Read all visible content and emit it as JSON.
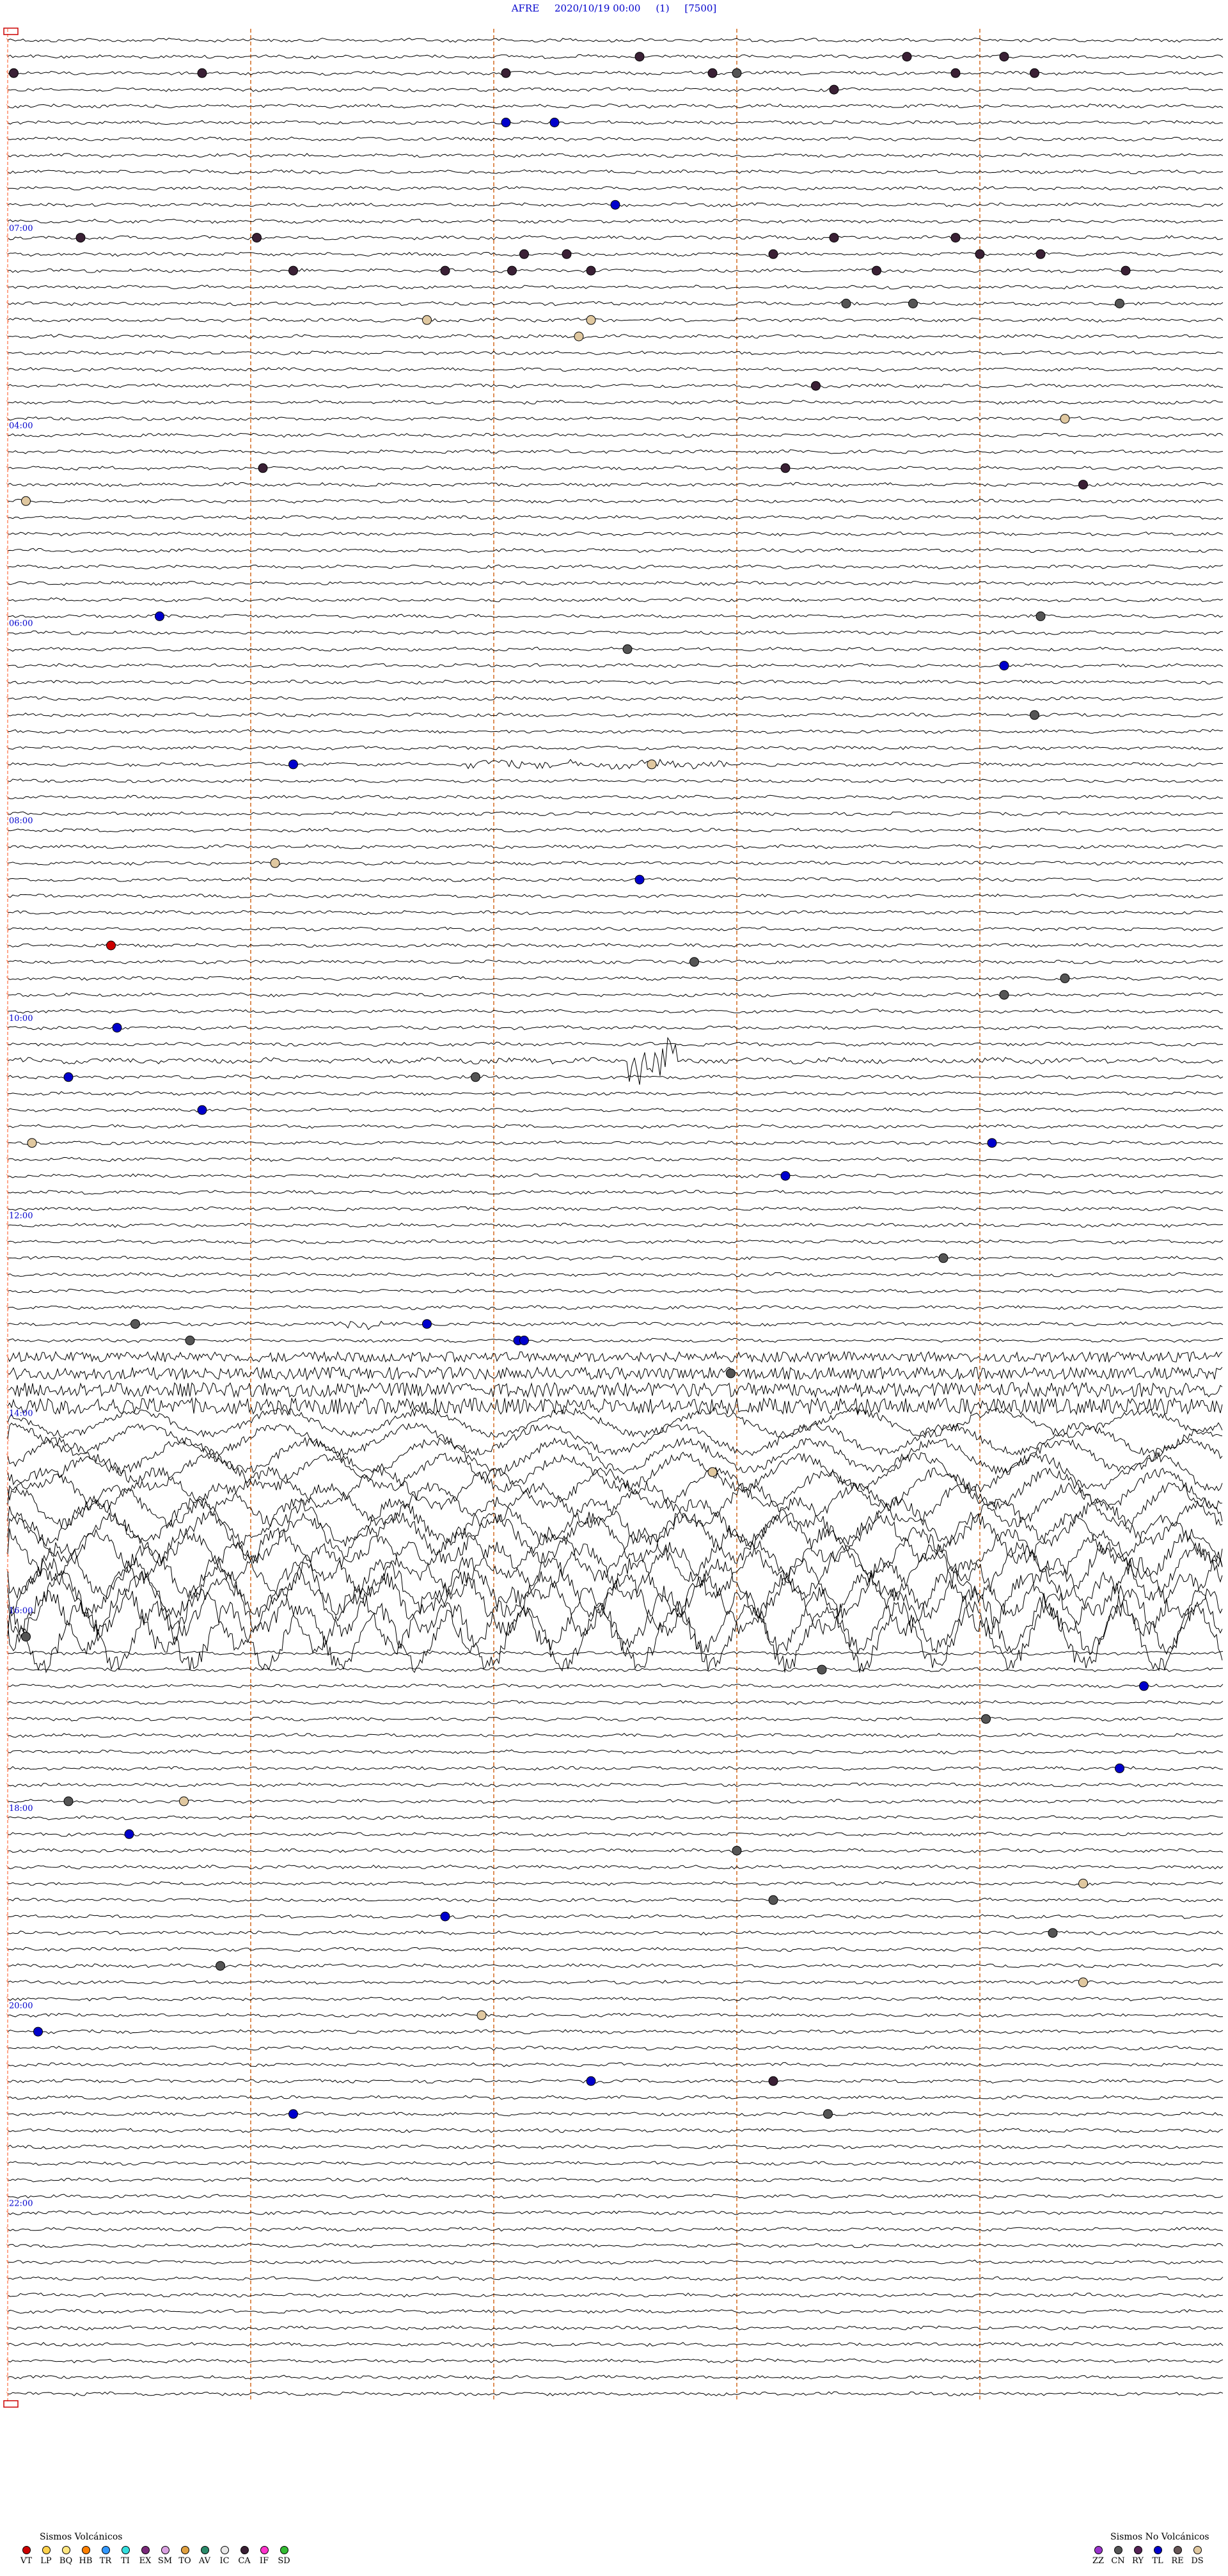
{
  "header": {
    "station": "AFRE",
    "datetime": "2020/10/19 00:00",
    "channel": "(1)",
    "scale": "[7500]"
  },
  "chart_data": {
    "type": "scatter",
    "description_type": "helicorder",
    "hour_labels": [
      "07:00",
      "04:00",
      "06:00",
      "08:00",
      "10:00",
      "12:00",
      "14:00",
      "16:00",
      "18:00",
      "20:00",
      "22:00"
    ],
    "hour_label_rows": [
      12,
      24,
      36,
      48,
      60,
      72,
      84,
      96,
      108,
      120,
      132
    ],
    "total_rows": 144,
    "x_range": [
      0,
      10
    ],
    "grid": {
      "vertical_markers_minutes": [
        2,
        4,
        6,
        8
      ],
      "color": "#d2691e"
    },
    "events": [
      {
        "row": 2,
        "x": 0.05,
        "type": "CA"
      },
      {
        "row": 2,
        "x": 1.6,
        "type": "CA"
      },
      {
        "row": 2,
        "x": 4.1,
        "type": "CA"
      },
      {
        "row": 1,
        "x": 5.2,
        "type": "CA"
      },
      {
        "row": 2,
        "x": 5.8,
        "type": "CA"
      },
      {
        "row": 2,
        "x": 6.0,
        "type": "CN"
      },
      {
        "row": 3,
        "x": 6.8,
        "type": "CA"
      },
      {
        "row": 1,
        "x": 7.4,
        "type": "CA"
      },
      {
        "row": 2,
        "x": 7.8,
        "type": "CA"
      },
      {
        "row": 1,
        "x": 8.2,
        "type": "CA"
      },
      {
        "row": 2,
        "x": 8.45,
        "type": "CA"
      },
      {
        "row": 5,
        "x": 4.1,
        "type": "TL"
      },
      {
        "row": 5,
        "x": 4.5,
        "type": "TL"
      },
      {
        "row": 10,
        "x": 5.0,
        "type": "TL"
      },
      {
        "row": 12,
        "x": 0.6,
        "type": "CA"
      },
      {
        "row": 12,
        "x": 2.05,
        "type": "CA"
      },
      {
        "row": 12,
        "x": 7.8,
        "type": "CA"
      },
      {
        "row": 13,
        "x": 4.25,
        "type": "CA"
      },
      {
        "row": 13,
        "x": 4.6,
        "type": "CA"
      },
      {
        "row": 13,
        "x": 6.3,
        "type": "CA"
      },
      {
        "row": 12,
        "x": 6.8,
        "type": "CA"
      },
      {
        "row": 13,
        "x": 8.0,
        "type": "CA"
      },
      {
        "row": 13,
        "x": 8.5,
        "type": "CA"
      },
      {
        "row": 14,
        "x": 2.35,
        "type": "CA"
      },
      {
        "row": 14,
        "x": 3.6,
        "type": "CA"
      },
      {
        "row": 14,
        "x": 4.15,
        "type": "CA"
      },
      {
        "row": 14,
        "x": 4.8,
        "type": "CA"
      },
      {
        "row": 14,
        "x": 7.15,
        "type": "CA"
      },
      {
        "row": 14,
        "x": 9.2,
        "type": "CA"
      },
      {
        "row": 16,
        "x": 6.9,
        "type": "CN"
      },
      {
        "row": 16,
        "x": 7.45,
        "type": "CN"
      },
      {
        "row": 16,
        "x": 9.15,
        "type": "CN"
      },
      {
        "row": 17,
        "x": 3.45,
        "type": "DS"
      },
      {
        "row": 17,
        "x": 4.8,
        "type": "DS"
      },
      {
        "row": 18,
        "x": 4.7,
        "type": "DS"
      },
      {
        "row": 21,
        "x": 6.65,
        "type": "CA"
      },
      {
        "row": 23,
        "x": 8.7,
        "type": "DS"
      },
      {
        "row": 26,
        "x": 6.4,
        "type": "CA"
      },
      {
        "row": 26,
        "x": 2.1,
        "type": "CA"
      },
      {
        "row": 27,
        "x": 8.85,
        "type": "CA"
      },
      {
        "row": 28,
        "x": 0.15,
        "type": "DS"
      },
      {
        "row": 35,
        "x": 1.25,
        "type": "TL"
      },
      {
        "row": 35,
        "x": 8.5,
        "type": "CN"
      },
      {
        "row": 37,
        "x": 5.1,
        "type": "CN"
      },
      {
        "row": 38,
        "x": 8.2,
        "type": "TL"
      },
      {
        "row": 41,
        "x": 8.45,
        "type": "CN"
      },
      {
        "row": 44,
        "x": 2.35,
        "type": "TL"
      },
      {
        "row": 44,
        "x": 5.3,
        "type": "DS"
      },
      {
        "row": 50,
        "x": 2.2,
        "type": "DS"
      },
      {
        "row": 51,
        "x": 5.2,
        "type": "TL"
      },
      {
        "row": 55,
        "x": 0.85,
        "type": "VT"
      },
      {
        "row": 56,
        "x": 5.65,
        "type": "CN"
      },
      {
        "row": 57,
        "x": 8.7,
        "type": "CN"
      },
      {
        "row": 58,
        "x": 8.2,
        "type": "CN"
      },
      {
        "row": 60,
        "x": 0.9,
        "type": "TL"
      },
      {
        "row": 63,
        "x": 0.5,
        "type": "TL"
      },
      {
        "row": 63,
        "x": 3.85,
        "type": "CN"
      },
      {
        "row": 65,
        "x": 1.6,
        "type": "TL"
      },
      {
        "row": 67,
        "x": 0.2,
        "type": "DS"
      },
      {
        "row": 67,
        "x": 8.1,
        "type": "TL"
      },
      {
        "row": 69,
        "x": 6.4,
        "type": "TL"
      },
      {
        "row": 74,
        "x": 7.7,
        "type": "CN"
      },
      {
        "row": 78,
        "x": 3.45,
        "type": "TL"
      },
      {
        "row": 78,
        "x": 1.05,
        "type": "CN"
      },
      {
        "row": 79,
        "x": 4.2,
        "type": "TL"
      },
      {
        "row": 79,
        "x": 4.25,
        "type": "TL"
      },
      {
        "row": 79,
        "x": 1.5,
        "type": "CN"
      },
      {
        "row": 81,
        "x": 5.95,
        "type": "CN"
      },
      {
        "row": 87,
        "x": 5.8,
        "type": "DS"
      },
      {
        "row": 97,
        "x": 0.15,
        "type": "CN"
      },
      {
        "row": 99,
        "x": 6.7,
        "type": "CN"
      },
      {
        "row": 100,
        "x": 9.35,
        "type": "TL"
      },
      {
        "row": 102,
        "x": 8.05,
        "type": "CN"
      },
      {
        "row": 105,
        "x": 9.15,
        "type": "TL"
      },
      {
        "row": 107,
        "x": 0.5,
        "type": "CN"
      },
      {
        "row": 107,
        "x": 1.45,
        "type": "DS"
      },
      {
        "row": 109,
        "x": 1.0,
        "type": "TL"
      },
      {
        "row": 110,
        "x": 6.0,
        "type": "CN"
      },
      {
        "row": 112,
        "x": 8.85,
        "type": "DS"
      },
      {
        "row": 113,
        "x": 6.3,
        "type": "CN"
      },
      {
        "row": 114,
        "x": 3.6,
        "type": "TL"
      },
      {
        "row": 115,
        "x": 8.6,
        "type": "CN"
      },
      {
        "row": 117,
        "x": 1.75,
        "type": "CN"
      },
      {
        "row": 118,
        "x": 8.85,
        "type": "DS"
      },
      {
        "row": 120,
        "x": 3.9,
        "type": "DS"
      },
      {
        "row": 121,
        "x": 0.25,
        "type": "TL"
      },
      {
        "row": 124,
        "x": 4.8,
        "type": "TL"
      },
      {
        "row": 124,
        "x": 6.3,
        "type": "CA"
      },
      {
        "row": 126,
        "x": 2.35,
        "type": "TL"
      },
      {
        "row": 126,
        "x": 6.75,
        "type": "CN"
      }
    ],
    "legend_volcanic": {
      "title": "Sismos Volcánicos",
      "items": [
        {
          "code": "VT",
          "color": "#cc0000"
        },
        {
          "code": "LP",
          "color": "#ffd24d"
        },
        {
          "code": "BQ",
          "color": "#ffe680"
        },
        {
          "code": "HB",
          "color": "#ff8000"
        },
        {
          "code": "TR",
          "color": "#3399ff"
        },
        {
          "code": "TI",
          "color": "#33dddd"
        },
        {
          "code": "EX",
          "color": "#7a2a7a"
        },
        {
          "code": "SM",
          "color": "#d9a0e0"
        },
        {
          "code": "TO",
          "color": "#e0a040"
        },
        {
          "code": "AV",
          "color": "#2a8a6a"
        },
        {
          "code": "IC",
          "color": "#e8e8e8"
        },
        {
          "code": "CA",
          "color": "#3a2035"
        },
        {
          "code": "IF",
          "color": "#ff33cc"
        },
        {
          "code": "SD",
          "color": "#33bb33"
        }
      ]
    },
    "legend_nonvolcanic": {
      "title": "Sismos No Volcánicos",
      "items": [
        {
          "code": "ZZ",
          "color": "#9933cc"
        },
        {
          "code": "CN",
          "color": "#555555"
        },
        {
          "code": "RY",
          "color": "#552255"
        },
        {
          "code": "TL",
          "color": "#0000cc"
        },
        {
          "code": "RE",
          "color": "#665555"
        },
        {
          "code": "DS",
          "color": "#e0c8a0"
        }
      ]
    }
  },
  "colors": {
    "trace": "#000000",
    "header_text": "#0000cc",
    "hour_label": "#0000cc",
    "marker_line": "#d2691e",
    "row_tick": "#ff8c69"
  }
}
